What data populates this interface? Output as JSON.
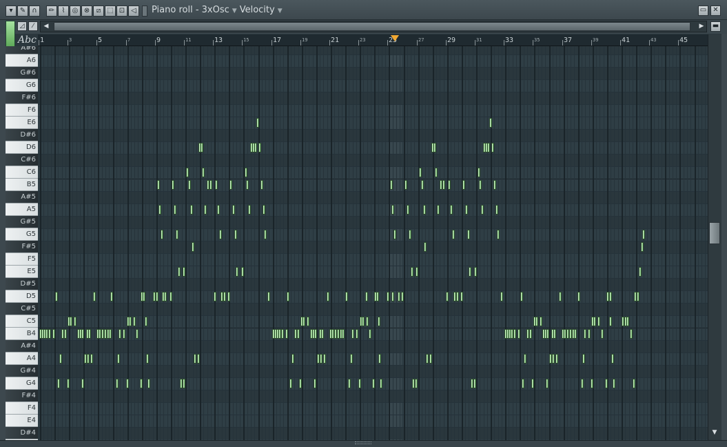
{
  "window": {
    "title": "Piano roll - 3xOsc",
    "target": "Velocity",
    "dropdown_glyph": "▼"
  },
  "toolbar": {
    "icons": [
      "menu-dropdown-icon",
      "wrench-icon",
      "magnet-icon",
      "pencil-icon",
      "brush-icon",
      "delete-icon",
      "mute-icon",
      "slice-icon",
      "select-icon",
      "zoom-icon",
      "playback-icon"
    ],
    "row2": {
      "tool_a": "◿",
      "tool_b": "⁄"
    },
    "abc_label": "Abc"
  },
  "ruler": {
    "labels": [
      "1",
      "3",
      "5",
      "7",
      "9",
      "11",
      "13",
      "15",
      "17",
      "19",
      "21",
      "23",
      "25",
      "27",
      "29",
      "31",
      "33",
      "35",
      "37",
      "39",
      "41",
      "43",
      "45"
    ],
    "playhead_bar": 25
  },
  "keys": [
    "A#6",
    "A6",
    "G#6",
    "G6",
    "F#6",
    "F6",
    "E6",
    "D#6",
    "D6",
    "C#6",
    "C6",
    "B5",
    "A#5",
    "A5",
    "G#5",
    "G5",
    "F#5",
    "F5",
    "E5",
    "D#5",
    "D5",
    "C#5",
    "C5",
    "B4",
    "A#4",
    "A4",
    "G#4",
    "G4",
    "F#4",
    "F4",
    "E4",
    "D#4"
  ],
  "colors": {
    "note_fill": "#c9f0c1",
    "playhead": "#f1a832",
    "grid_bg": "#2f3e45"
  },
  "notes": [
    [
      "E6",
      [
        372
      ]
    ],
    [
      "D6",
      [
        288,
        291,
        363,
        366,
        369,
        375
      ]
    ],
    [
      "C6",
      [
        270,
        293,
        355
      ]
    ],
    [
      "B5",
      [
        228,
        249,
        273,
        300,
        304,
        312,
        333,
        357,
        378
      ]
    ],
    [
      "A5",
      [
        230,
        252,
        276,
        296,
        315,
        337,
        360,
        381
      ]
    ],
    [
      "G5",
      [
        233,
        255,
        318,
        340,
        383
      ]
    ],
    [
      "F#5",
      [
        278
      ]
    ],
    [
      "E5",
      [
        258,
        265,
        342,
        350
      ]
    ],
    [
      "D5",
      [
        80,
        135,
        160,
        204,
        207,
        222,
        226,
        235,
        238,
        246,
        310,
        320,
        324,
        330,
        388,
        416,
        474,
        501,
        530,
        543,
        546,
        561,
        568,
        577,
        582
      ]
    ],
    [
      "C5",
      [
        98,
        101,
        107,
        184,
        187,
        193,
        210
      ]
    ],
    [
      "B4",
      [
        57,
        60,
        63,
        66,
        70,
        76,
        89,
        93,
        112,
        115,
        118,
        125,
        128,
        140,
        143,
        147,
        151,
        155,
        158,
        172,
        178,
        197
      ]
    ],
    [
      "A4",
      [
        86,
        122,
        126,
        131,
        170,
        212,
        281,
        286
      ]
    ],
    [
      "G4",
      [
        83,
        97,
        118,
        168,
        183,
        203,
        214,
        261,
        265
      ]
    ],
    [
      "E6b",
      [
        710
      ]
    ],
    [
      "D6b",
      [
        626,
        629,
        701,
        704,
        707,
        713
      ]
    ],
    [
      "C6b",
      [
        608,
        631,
        693
      ]
    ],
    [
      "B5b",
      [
        566,
        587,
        611,
        638,
        642,
        650,
        671,
        695,
        716
      ]
    ],
    [
      "A5b",
      [
        568,
        590,
        614,
        634,
        653,
        675,
        698,
        719
      ]
    ],
    [
      "G5b",
      [
        571,
        593,
        656,
        678,
        721,
        932
      ]
    ],
    [
      "F#5b",
      [
        615,
        930
      ]
    ],
    [
      "E5b",
      [
        596,
        603,
        680,
        688,
        927
      ]
    ],
    [
      "D5b",
      [
        647,
        658,
        662,
        668,
        726,
        755,
        811,
        838,
        880,
        884,
        920,
        924
      ]
    ],
    [
      "C5b",
      [
        436,
        439,
        445,
        522,
        525,
        531,
        548,
        774,
        777,
        783,
        858,
        861,
        867,
        884,
        902,
        906,
        909
      ]
    ],
    [
      "B4b",
      [
        395,
        398,
        401,
        404,
        408,
        414,
        427,
        431,
        450,
        453,
        456,
        463,
        466,
        478,
        481,
        485,
        489,
        493,
        496,
        510,
        516,
        535,
        732,
        735,
        738,
        741,
        745,
        751,
        764,
        768,
        787,
        790,
        793,
        800,
        803,
        815,
        818,
        822,
        826,
        830,
        833,
        847,
        853,
        872,
        914
      ]
    ],
    [
      "A4b",
      [
        423,
        460,
        464,
        469,
        508,
        549,
        618,
        623,
        760,
        797,
        801,
        806,
        845,
        887
      ]
    ],
    [
      "G4b",
      [
        420,
        434,
        455,
        505,
        520,
        540,
        551,
        598,
        602,
        683,
        687,
        757,
        771,
        792,
        843,
        857,
        878,
        889,
        918
      ]
    ]
  ]
}
